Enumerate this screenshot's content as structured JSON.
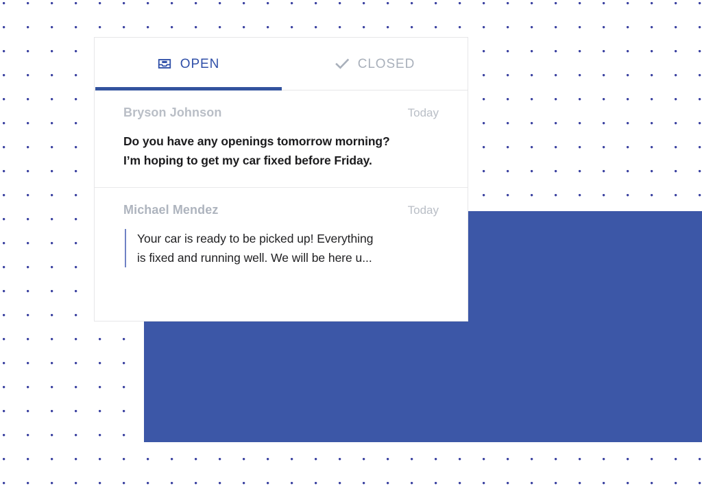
{
  "theme": {
    "accent_blue": "#33539e",
    "block_blue": "#3c57a7",
    "dot_blue": "#32399c",
    "muted_gray": "#b9bec6",
    "text_dark": "#1b1b1d"
  },
  "tabs": [
    {
      "id": "open",
      "label": "OPEN",
      "icon": "inbox-icon",
      "active": true
    },
    {
      "id": "closed",
      "label": "CLOSED",
      "icon": "check-icon",
      "active": false
    }
  ],
  "messages": [
    {
      "sender": "Bryson Johnson",
      "timestamp": "Today",
      "preview_line_1": "Do you have any openings tomorrow morning?",
      "preview_line_2": "I’m hoping to get my car fixed before Friday.",
      "unread": true,
      "quoted": false
    },
    {
      "sender": "Michael Mendez",
      "timestamp": "Today",
      "preview_line_1": "Your car is ready to be picked up! Everything",
      "preview_line_2": "is fixed and running well. We will be here u...",
      "unread": false,
      "quoted": true
    }
  ]
}
